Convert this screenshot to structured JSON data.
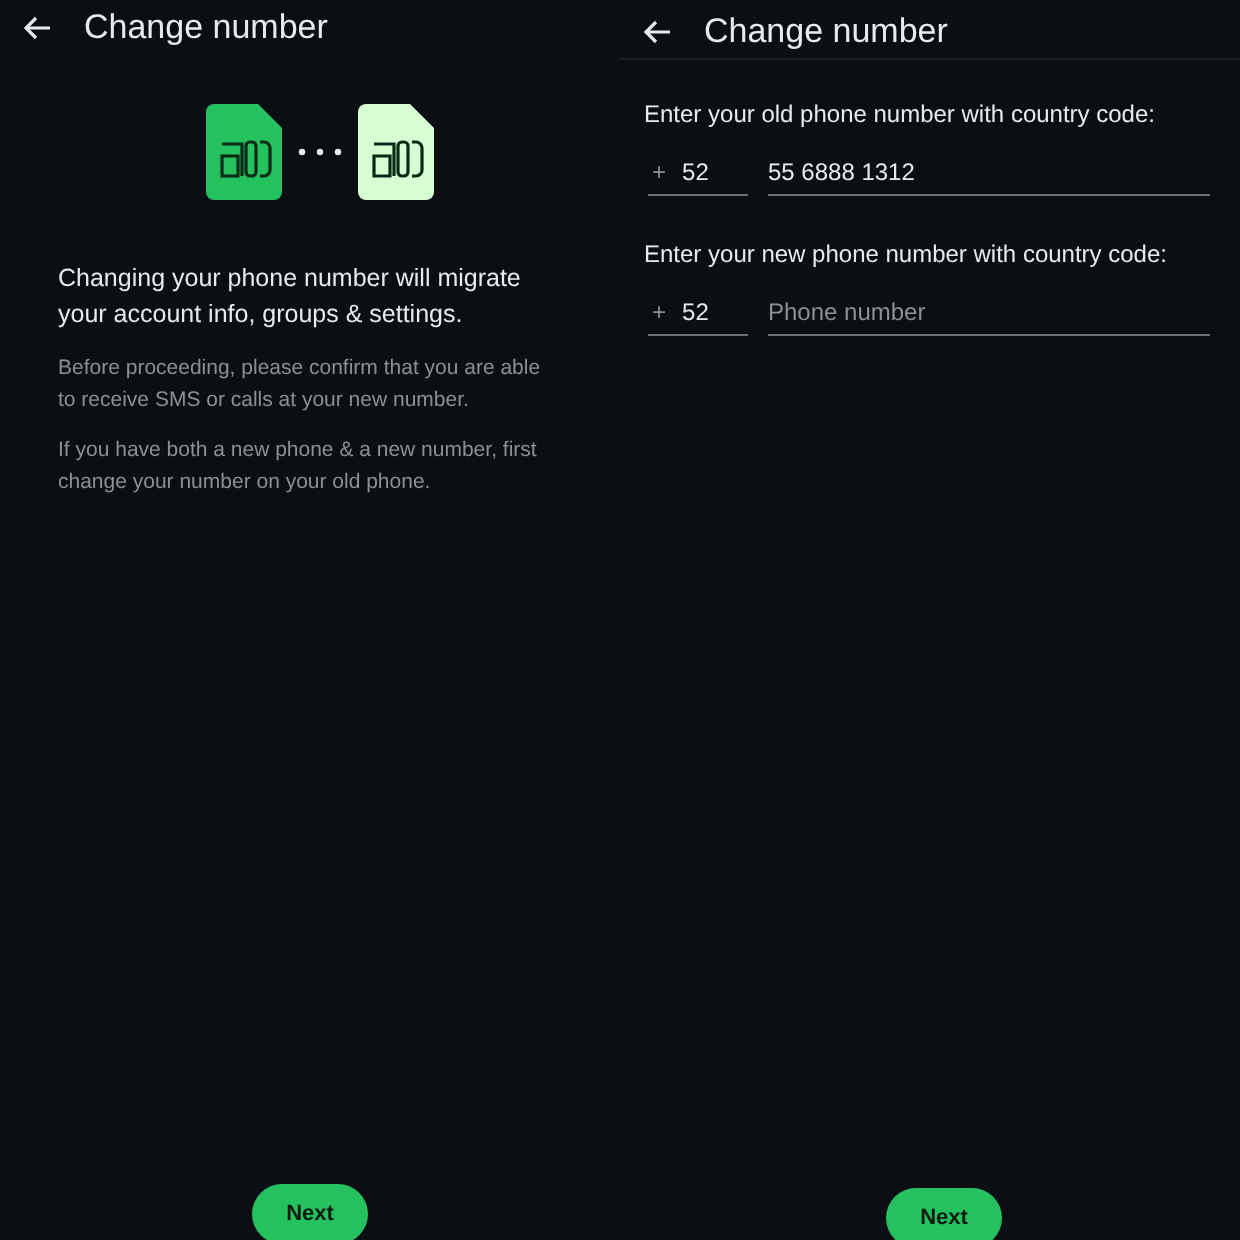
{
  "screens": [
    {
      "kind": "intro",
      "title": "Change number",
      "headline": "Changing your phone number will migrate your account info, groups & settings.",
      "notes": [
        "Before proceeding, please confirm that you are able to receive SMS or calls at your new number.",
        "If you have both a new phone & a new number, first change your number on your old phone."
      ],
      "button": "Next"
    },
    {
      "kind": "form",
      "title": "Change number",
      "fields": [
        {
          "label": "Enter your old phone number with country code:",
          "prefix": "+",
          "code": "52",
          "value": "55 6888 1312"
        },
        {
          "label": "Enter your new phone number with country code:",
          "prefix": "+",
          "code": "52",
          "placeholder": "Phone number"
        }
      ],
      "button": "Next"
    }
  ]
}
